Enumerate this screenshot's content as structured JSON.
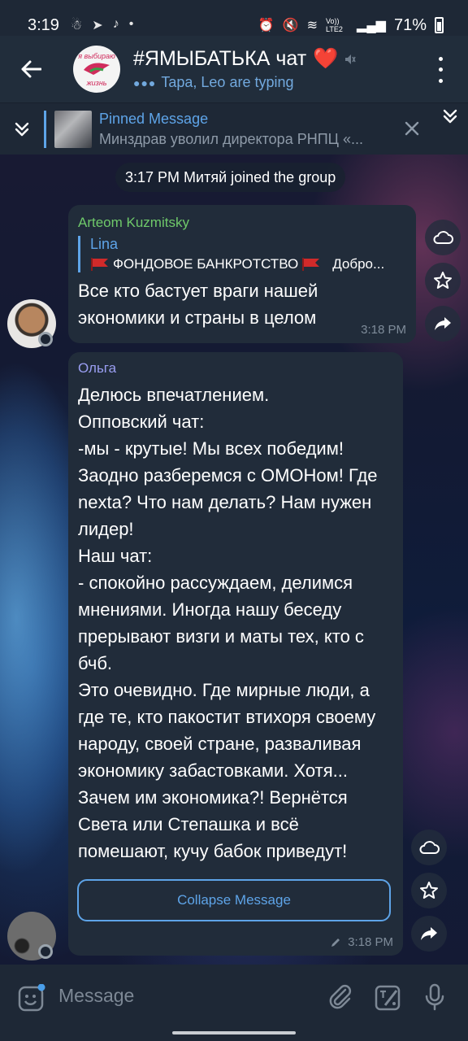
{
  "status_bar": {
    "time": "3:19",
    "lte": "Vo)) LTE2",
    "battery": "71%"
  },
  "header": {
    "avatar_text_top": "я выбираю",
    "avatar_text_bottom": "жизнь",
    "title": "#ЯМЫБАТЬКА чат",
    "title_emoji": "❤️",
    "status": "Tapa, Leo are typing"
  },
  "pinned": {
    "label": "Pinned Message",
    "text": "Минздрав уволил директора РНПЦ «..."
  },
  "service_message": "3:17 PM Митяй joined the group",
  "messages": [
    {
      "sender": "Arteom Kuzmitsky",
      "reply_name": "Lina",
      "reply_text": "ФОНДОВОЕ БАНКРОТСТВО",
      "reply_text_tail": "Добро...",
      "text_lines": [
        "Все кто бастует враги нашей",
        "экономики и страны в целом"
      ],
      "time": "3:18 PM"
    },
    {
      "sender": "Ольга",
      "text_lines": [
        "Делюсь впечатлением.",
        "Опповский чат:",
        "-мы - крутые! Мы всех победим!",
        "Заодно разберемся с ОМОНом! Где",
        "nexta? Что нам делать? Нам нужен",
        "лидер!",
        "Наш чат:",
        "- спокойно рассуждаем, делимся",
        "мнениями. Иногда нашу беседу",
        "прерывают визги и маты тех, кто с",
        "бчб.",
        "Это очевидно. Где мирные люди, а",
        "где те, кто пакостит втихоря своему",
        "народу, своей стране, разваливая",
        "экономику забастовками. Хотя...",
        "Зачем им экономика?! Вернётся",
        "Света или Степашка и всё",
        "помешают, кучу бабок приведут!"
      ],
      "collapse_label": "Collapse Message",
      "time": "3:18 PM"
    }
  ],
  "input": {
    "placeholder": "Message"
  },
  "colors": {
    "accent": "#5ea4e8",
    "bubble": "#212c3a",
    "header": "#212d3b",
    "sender_green": "#6fc96a",
    "sender_violet": "#9a9ef2"
  },
  "icons": [
    "back-arrow-icon",
    "mute-icon",
    "more-vert-icon",
    "chevron-double-down-icon",
    "close-icon",
    "cloud-icon",
    "star-icon",
    "share-icon",
    "emoji-icon",
    "attach-icon",
    "sticker-icon",
    "mic-icon",
    "pencil-icon"
  ]
}
